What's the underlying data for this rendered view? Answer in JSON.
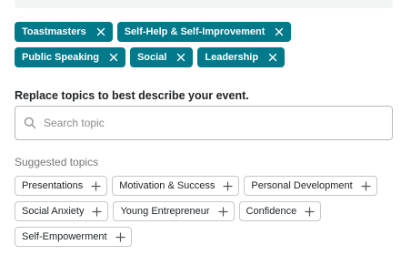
{
  "selected_topics": [
    {
      "label": "Toastmasters",
      "remove_icon": "close-icon"
    },
    {
      "label": "Self-Help & Self-Improvement",
      "remove_icon": "close-icon"
    },
    {
      "label": "Public Speaking",
      "remove_icon": "close-icon"
    },
    {
      "label": "Social",
      "remove_icon": "close-icon"
    },
    {
      "label": "Leadership",
      "remove_icon": "close-icon"
    }
  ],
  "prompt": "Replace topics to best describe your event.",
  "search": {
    "placeholder": "Search topic",
    "value": "",
    "icon": "search-icon"
  },
  "suggested": {
    "title": "Suggested topics",
    "items": [
      {
        "label": "Presentations",
        "add_icon": "plus-icon"
      },
      {
        "label": "Motivation & Success",
        "add_icon": "plus-icon"
      },
      {
        "label": "Personal Development",
        "add_icon": "plus-icon"
      },
      {
        "label": "Social Anxiety",
        "add_icon": "plus-icon"
      },
      {
        "label": "Young Entrepreneur",
        "add_icon": "plus-icon"
      },
      {
        "label": "Confidence",
        "add_icon": "plus-icon"
      },
      {
        "label": "Self-Empowerment",
        "add_icon": "plus-icon"
      }
    ]
  },
  "colors": {
    "chip_background": "#00798a",
    "chip_text": "#ffffff",
    "suggestion_border": "#c7c7c7",
    "muted_text": "#767676"
  }
}
